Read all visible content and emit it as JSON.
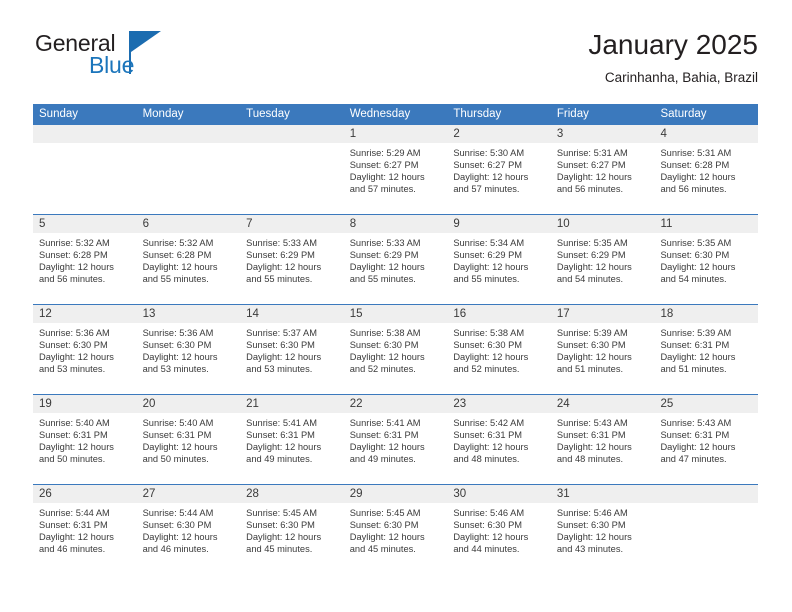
{
  "brand": {
    "word_one": "General",
    "word_two": "Blue",
    "mark_icon": "triangle-flag-icon"
  },
  "header": {
    "title": "January 2025",
    "subtitle": "Carinhanha, Bahia, Brazil"
  },
  "colors": {
    "header_blue": "#3b79bd",
    "brand_blue": "#1b75bb",
    "day_band_gray": "#efefef",
    "text_dark": "#231f20",
    "cell_text": "#3a3a3a"
  },
  "calendar": {
    "weekday_headers": [
      "Sunday",
      "Monday",
      "Tuesday",
      "Wednesday",
      "Thursday",
      "Friday",
      "Saturday"
    ],
    "weeks": [
      [
        {
          "day": "",
          "empty": true,
          "sunrise": "",
          "sunset": "",
          "daylight_line1": "",
          "daylight_line2": ""
        },
        {
          "day": "",
          "empty": true,
          "sunrise": "",
          "sunset": "",
          "daylight_line1": "",
          "daylight_line2": ""
        },
        {
          "day": "",
          "empty": true,
          "sunrise": "",
          "sunset": "",
          "daylight_line1": "",
          "daylight_line2": ""
        },
        {
          "day": "1",
          "empty": false,
          "sunrise": "Sunrise: 5:29 AM",
          "sunset": "Sunset: 6:27 PM",
          "daylight_line1": "Daylight: 12 hours",
          "daylight_line2": "and 57 minutes."
        },
        {
          "day": "2",
          "empty": false,
          "sunrise": "Sunrise: 5:30 AM",
          "sunset": "Sunset: 6:27 PM",
          "daylight_line1": "Daylight: 12 hours",
          "daylight_line2": "and 57 minutes."
        },
        {
          "day": "3",
          "empty": false,
          "sunrise": "Sunrise: 5:31 AM",
          "sunset": "Sunset: 6:27 PM",
          "daylight_line1": "Daylight: 12 hours",
          "daylight_line2": "and 56 minutes."
        },
        {
          "day": "4",
          "empty": false,
          "sunrise": "Sunrise: 5:31 AM",
          "sunset": "Sunset: 6:28 PM",
          "daylight_line1": "Daylight: 12 hours",
          "daylight_line2": "and 56 minutes."
        }
      ],
      [
        {
          "day": "5",
          "empty": false,
          "sunrise": "Sunrise: 5:32 AM",
          "sunset": "Sunset: 6:28 PM",
          "daylight_line1": "Daylight: 12 hours",
          "daylight_line2": "and 56 minutes."
        },
        {
          "day": "6",
          "empty": false,
          "sunrise": "Sunrise: 5:32 AM",
          "sunset": "Sunset: 6:28 PM",
          "daylight_line1": "Daylight: 12 hours",
          "daylight_line2": "and 55 minutes."
        },
        {
          "day": "7",
          "empty": false,
          "sunrise": "Sunrise: 5:33 AM",
          "sunset": "Sunset: 6:29 PM",
          "daylight_line1": "Daylight: 12 hours",
          "daylight_line2": "and 55 minutes."
        },
        {
          "day": "8",
          "empty": false,
          "sunrise": "Sunrise: 5:33 AM",
          "sunset": "Sunset: 6:29 PM",
          "daylight_line1": "Daylight: 12 hours",
          "daylight_line2": "and 55 minutes."
        },
        {
          "day": "9",
          "empty": false,
          "sunrise": "Sunrise: 5:34 AM",
          "sunset": "Sunset: 6:29 PM",
          "daylight_line1": "Daylight: 12 hours",
          "daylight_line2": "and 55 minutes."
        },
        {
          "day": "10",
          "empty": false,
          "sunrise": "Sunrise: 5:35 AM",
          "sunset": "Sunset: 6:29 PM",
          "daylight_line1": "Daylight: 12 hours",
          "daylight_line2": "and 54 minutes."
        },
        {
          "day": "11",
          "empty": false,
          "sunrise": "Sunrise: 5:35 AM",
          "sunset": "Sunset: 6:30 PM",
          "daylight_line1": "Daylight: 12 hours",
          "daylight_line2": "and 54 minutes."
        }
      ],
      [
        {
          "day": "12",
          "empty": false,
          "sunrise": "Sunrise: 5:36 AM",
          "sunset": "Sunset: 6:30 PM",
          "daylight_line1": "Daylight: 12 hours",
          "daylight_line2": "and 53 minutes."
        },
        {
          "day": "13",
          "empty": false,
          "sunrise": "Sunrise: 5:36 AM",
          "sunset": "Sunset: 6:30 PM",
          "daylight_line1": "Daylight: 12 hours",
          "daylight_line2": "and 53 minutes."
        },
        {
          "day": "14",
          "empty": false,
          "sunrise": "Sunrise: 5:37 AM",
          "sunset": "Sunset: 6:30 PM",
          "daylight_line1": "Daylight: 12 hours",
          "daylight_line2": "and 53 minutes."
        },
        {
          "day": "15",
          "empty": false,
          "sunrise": "Sunrise: 5:38 AM",
          "sunset": "Sunset: 6:30 PM",
          "daylight_line1": "Daylight: 12 hours",
          "daylight_line2": "and 52 minutes."
        },
        {
          "day": "16",
          "empty": false,
          "sunrise": "Sunrise: 5:38 AM",
          "sunset": "Sunset: 6:30 PM",
          "daylight_line1": "Daylight: 12 hours",
          "daylight_line2": "and 52 minutes."
        },
        {
          "day": "17",
          "empty": false,
          "sunrise": "Sunrise: 5:39 AM",
          "sunset": "Sunset: 6:30 PM",
          "daylight_line1": "Daylight: 12 hours",
          "daylight_line2": "and 51 minutes."
        },
        {
          "day": "18",
          "empty": false,
          "sunrise": "Sunrise: 5:39 AM",
          "sunset": "Sunset: 6:31 PM",
          "daylight_line1": "Daylight: 12 hours",
          "daylight_line2": "and 51 minutes."
        }
      ],
      [
        {
          "day": "19",
          "empty": false,
          "sunrise": "Sunrise: 5:40 AM",
          "sunset": "Sunset: 6:31 PM",
          "daylight_line1": "Daylight: 12 hours",
          "daylight_line2": "and 50 minutes."
        },
        {
          "day": "20",
          "empty": false,
          "sunrise": "Sunrise: 5:40 AM",
          "sunset": "Sunset: 6:31 PM",
          "daylight_line1": "Daylight: 12 hours",
          "daylight_line2": "and 50 minutes."
        },
        {
          "day": "21",
          "empty": false,
          "sunrise": "Sunrise: 5:41 AM",
          "sunset": "Sunset: 6:31 PM",
          "daylight_line1": "Daylight: 12 hours",
          "daylight_line2": "and 49 minutes."
        },
        {
          "day": "22",
          "empty": false,
          "sunrise": "Sunrise: 5:41 AM",
          "sunset": "Sunset: 6:31 PM",
          "daylight_line1": "Daylight: 12 hours",
          "daylight_line2": "and 49 minutes."
        },
        {
          "day": "23",
          "empty": false,
          "sunrise": "Sunrise: 5:42 AM",
          "sunset": "Sunset: 6:31 PM",
          "daylight_line1": "Daylight: 12 hours",
          "daylight_line2": "and 48 minutes."
        },
        {
          "day": "24",
          "empty": false,
          "sunrise": "Sunrise: 5:43 AM",
          "sunset": "Sunset: 6:31 PM",
          "daylight_line1": "Daylight: 12 hours",
          "daylight_line2": "and 48 minutes."
        },
        {
          "day": "25",
          "empty": false,
          "sunrise": "Sunrise: 5:43 AM",
          "sunset": "Sunset: 6:31 PM",
          "daylight_line1": "Daylight: 12 hours",
          "daylight_line2": "and 47 minutes."
        }
      ],
      [
        {
          "day": "26",
          "empty": false,
          "sunrise": "Sunrise: 5:44 AM",
          "sunset": "Sunset: 6:31 PM",
          "daylight_line1": "Daylight: 12 hours",
          "daylight_line2": "and 46 minutes."
        },
        {
          "day": "27",
          "empty": false,
          "sunrise": "Sunrise: 5:44 AM",
          "sunset": "Sunset: 6:30 PM",
          "daylight_line1": "Daylight: 12 hours",
          "daylight_line2": "and 46 minutes."
        },
        {
          "day": "28",
          "empty": false,
          "sunrise": "Sunrise: 5:45 AM",
          "sunset": "Sunset: 6:30 PM",
          "daylight_line1": "Daylight: 12 hours",
          "daylight_line2": "and 45 minutes."
        },
        {
          "day": "29",
          "empty": false,
          "sunrise": "Sunrise: 5:45 AM",
          "sunset": "Sunset: 6:30 PM",
          "daylight_line1": "Daylight: 12 hours",
          "daylight_line2": "and 45 minutes."
        },
        {
          "day": "30",
          "empty": false,
          "sunrise": "Sunrise: 5:46 AM",
          "sunset": "Sunset: 6:30 PM",
          "daylight_line1": "Daylight: 12 hours",
          "daylight_line2": "and 44 minutes."
        },
        {
          "day": "31",
          "empty": false,
          "sunrise": "Sunrise: 5:46 AM",
          "sunset": "Sunset: 6:30 PM",
          "daylight_line1": "Daylight: 12 hours",
          "daylight_line2": "and 43 minutes."
        },
        {
          "day": "",
          "empty": true,
          "sunrise": "",
          "sunset": "",
          "daylight_line1": "",
          "daylight_line2": ""
        }
      ]
    ]
  }
}
